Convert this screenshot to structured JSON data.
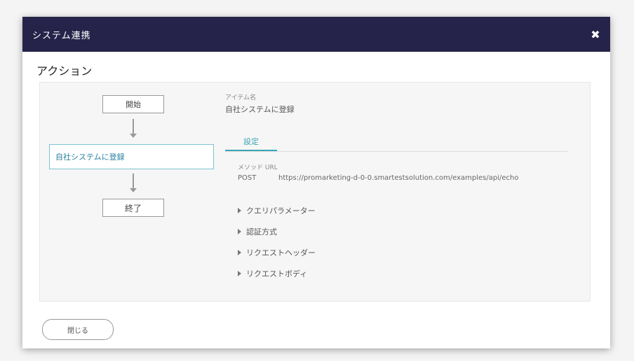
{
  "window": {
    "title": "システム連携",
    "close_glyph": "✖"
  },
  "section": {
    "title": "アクション"
  },
  "flow": {
    "start_label": "開始",
    "action_label": "自社システムに登録",
    "end_label": "終了"
  },
  "detail": {
    "name_label": "アイテム名",
    "name_value": "自社システムに登録",
    "tab_label": "設定",
    "method_url_label": "メソッド URL",
    "method": "POST",
    "url": "https://promarketing-d-0-0.smartestsolution.com/examples/api/echo",
    "expandables": [
      "クエリパラメーター",
      "認証方式",
      "リクエストヘッダー",
      "リクエストボディ"
    ]
  },
  "footer": {
    "close_button_label": "閉じる"
  }
}
